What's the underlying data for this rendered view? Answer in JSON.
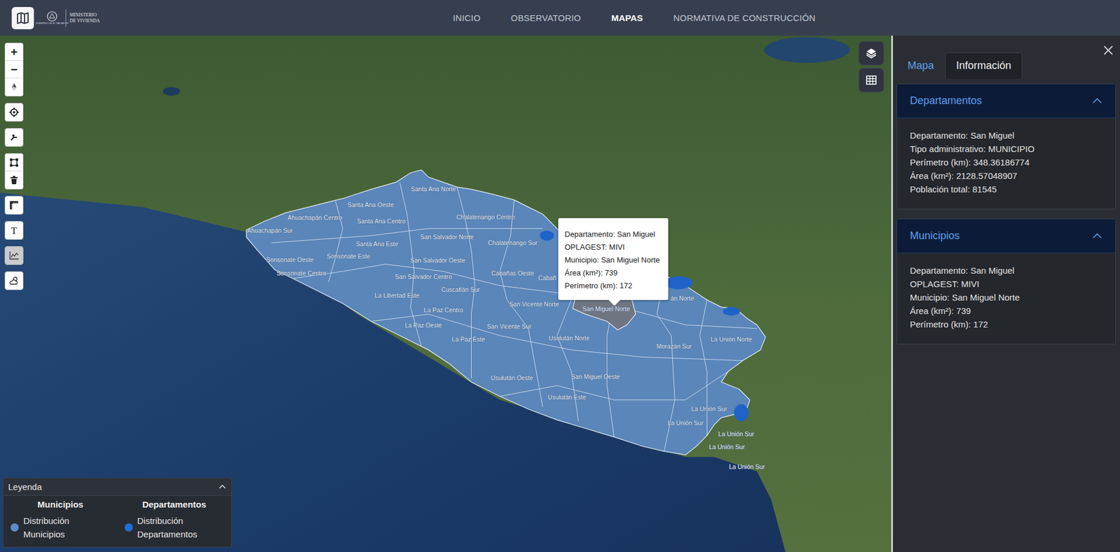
{
  "nav": {
    "brand": {
      "line1": "MINISTERIO",
      "line2": "DE VIVIENDA",
      "seal": "GOBIERNO DE EL SALVADOR"
    },
    "items": [
      {
        "label": "INICIO",
        "selected": false
      },
      {
        "label": "OBSERVATORIO",
        "selected": false
      },
      {
        "label": "MAPAS",
        "selected": true
      },
      {
        "label": "NORMATIVA DE CONSTRUCCIÓN",
        "selected": false
      }
    ]
  },
  "tools": [
    {
      "kind": "zoom-in",
      "glyph": "+",
      "active": false
    },
    {
      "kind": "zoom-out",
      "glyph": "−",
      "active": false
    },
    {
      "kind": "compass",
      "active": false
    },
    {
      "kind": "locate",
      "active": false
    },
    {
      "kind": "route",
      "active": false
    },
    {
      "kind": "draw",
      "active": false
    },
    {
      "kind": "trash",
      "active": false
    },
    {
      "kind": "measure",
      "active": false
    },
    {
      "kind": "text",
      "glyph": "T",
      "active": false
    },
    {
      "kind": "chart",
      "active": true
    },
    {
      "kind": "weather",
      "active": false
    }
  ],
  "map_labels": [
    {
      "text": "Santa Ana Norte",
      "selected": false
    },
    {
      "text": "Santa Ana Oeste",
      "selected": false
    },
    {
      "text": "Ahuachapán Centro",
      "selected": false
    },
    {
      "text": "Chalatenango Centro",
      "selected": false
    },
    {
      "text": "Santa Ana Centro",
      "selected": false
    },
    {
      "text": "Ahuachapán Sur",
      "selected": false
    },
    {
      "text": "San Salvador Norte",
      "selected": false
    },
    {
      "text": "Chalatenango Sur",
      "selected": false
    },
    {
      "text": "Santa Ana Este",
      "selected": false
    },
    {
      "text": "Sonsonate Este",
      "selected": false
    },
    {
      "text": "Sonsonate Oeste",
      "selected": false
    },
    {
      "text": "San Salvador Oeste",
      "selected": false
    },
    {
      "text": "Cabañas Oeste",
      "selected": false
    },
    {
      "text": "Cabañ",
      "selected": false
    },
    {
      "text": "án Norte",
      "selected": false
    },
    {
      "text": "Sonsonate Centro",
      "selected": false
    },
    {
      "text": "San Salvador Centro",
      "selected": false
    },
    {
      "text": "Cuscatlán Sur",
      "selected": false
    },
    {
      "text": "La Libertad Este",
      "selected": false
    },
    {
      "text": "San Vicente Norte",
      "selected": false
    },
    {
      "text": "San Miguel Norte",
      "selected": true
    },
    {
      "text": "La Paz Centro",
      "selected": false
    },
    {
      "text": "La Paz Oeste",
      "selected": false
    },
    {
      "text": "San Vicente Sur",
      "selected": false
    },
    {
      "text": "Usulután Norte",
      "selected": false
    },
    {
      "text": "La Paz Este",
      "selected": false
    },
    {
      "text": "La Unión Norte",
      "selected": false
    },
    {
      "text": "Morazán Sur",
      "selected": false
    },
    {
      "text": "San Miguel Oeste",
      "selected": false
    },
    {
      "text": "Usulután Oeste",
      "selected": false
    },
    {
      "text": "Usulután Este",
      "selected": false
    },
    {
      "text": "La Unión Sur",
      "selected": false
    },
    {
      "text": "La Unión Sur",
      "selected": false
    },
    {
      "text": "La Unión Sur",
      "selected": false
    },
    {
      "text": "La Unión Sur",
      "selected": false
    },
    {
      "text": "La Unión Sur",
      "selected": false
    }
  ],
  "tooltip": {
    "lines": [
      "Departamento: San Miguel",
      "OPLAGEST: MIVI",
      "Municipio: San Miguel Norte",
      "Área (km²): 739",
      "Perímetro (km): 172"
    ]
  },
  "legend": {
    "title": "Leyenda",
    "expanded": true,
    "groups": [
      {
        "title": "Municipios",
        "items": [
          {
            "label": "Distribución Municipios",
            "color": "#5b8cc4"
          }
        ]
      },
      {
        "title": "Departamentos",
        "items": [
          {
            "label": "Distribución Departamentos",
            "color": "#1f6fd6"
          }
        ]
      }
    ]
  },
  "panel": {
    "tabs": [
      {
        "label": "Mapa",
        "selected": false
      },
      {
        "label": "Información",
        "selected": true
      }
    ],
    "sections": [
      {
        "title": "Departamentos",
        "expanded": true,
        "lines": [
          "Departamento: San Miguel",
          "Tipo administrativo: MUNICIPIO",
          "Perímetro (km): 348.36186774",
          "Área (km²): 2128.57048907",
          "Población total: 81545"
        ]
      },
      {
        "title": "Municipios",
        "expanded": true,
        "lines": [
          "Departamento: San Miguel",
          "OPLAGEST: MIVI",
          "Municipio: San Miguel Norte",
          "Área (km²): 739",
          "Perímetro (km): 172"
        ]
      }
    ]
  }
}
